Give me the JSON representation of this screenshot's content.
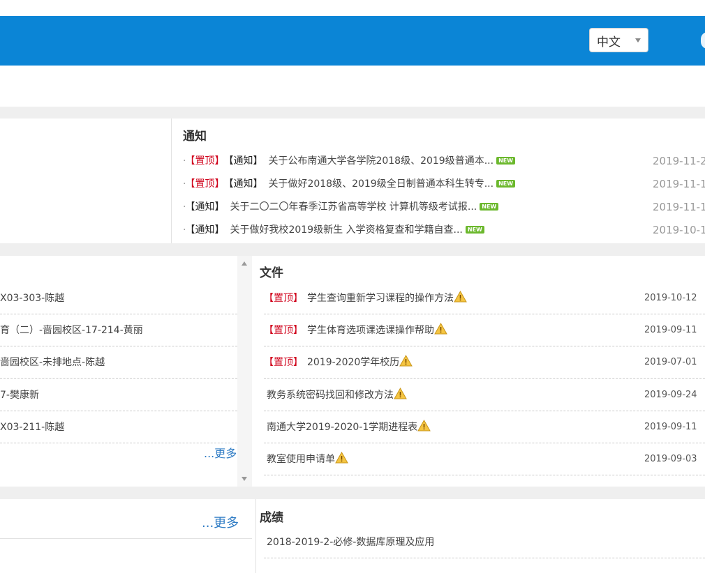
{
  "header": {
    "language": {
      "selected": "中文"
    }
  },
  "notice": {
    "title": "通知",
    "items": [
      {
        "tags": [
          "【置顶】",
          "【通知】"
        ],
        "text": "关于公布南通大学各学院2018级、2019级普通本...",
        "badge": "NEW",
        "date": "2019-11-2"
      },
      {
        "tags": [
          "【置顶】",
          "【通知】"
        ],
        "text": "关于做好2018级、2019级全日制普通本科生转专...",
        "badge": "NEW",
        "date": "2019-11-1"
      },
      {
        "tags": [
          "【通知】"
        ],
        "text": "关于二〇二〇年春季江苏省高等学校 计算机等级考试报...",
        "badge": "NEW",
        "date": "2019-11-1"
      },
      {
        "tags": [
          "【通知】"
        ],
        "text": "关于做好我校2019级新生 入学资格复查和学籍自查...",
        "badge": "NEW",
        "date": "2019-10-1"
      }
    ]
  },
  "left_list": {
    "items": [
      {
        "text": "X03-303-陈越"
      },
      {
        "text": "育（二）-啬园校区-17-214-黄丽"
      },
      {
        "text": "啬园校区-未排地点-陈越"
      },
      {
        "text": "7-樊康新"
      },
      {
        "text": "X03-211-陈越"
      }
    ],
    "more": "...更多"
  },
  "files": {
    "title": "文件",
    "pin_tag": "【置顶】",
    "items": [
      {
        "pinned": true,
        "text": "学生查询重新学习课程的操作方法",
        "date": "2019-10-12"
      },
      {
        "pinned": true,
        "text": "学生体育选项课选课操作帮助",
        "date": "2019-09-11"
      },
      {
        "pinned": true,
        "text": "2019-2020学年校历",
        "date": "2019-07-01"
      },
      {
        "pinned": false,
        "text": "教务系统密码找回和修改方法",
        "date": "2019-09-24"
      },
      {
        "pinned": false,
        "text": "南通大学2019-2020-1学期进程表",
        "date": "2019-09-11"
      },
      {
        "pinned": false,
        "text": "教室使用申请单",
        "date": "2019-09-03"
      }
    ]
  },
  "lower_left": {
    "more": "...更多"
  },
  "scores": {
    "title": "成绩",
    "items": [
      {
        "text": "2018-2019-2-必修-数据库原理及应用"
      }
    ]
  },
  "colors": {
    "header_blue": "#0b85d6",
    "pin_red": "#d0021b",
    "link_blue": "#2e7bc4",
    "new_green": "#6bb82c",
    "band_gray": "#efefef"
  }
}
